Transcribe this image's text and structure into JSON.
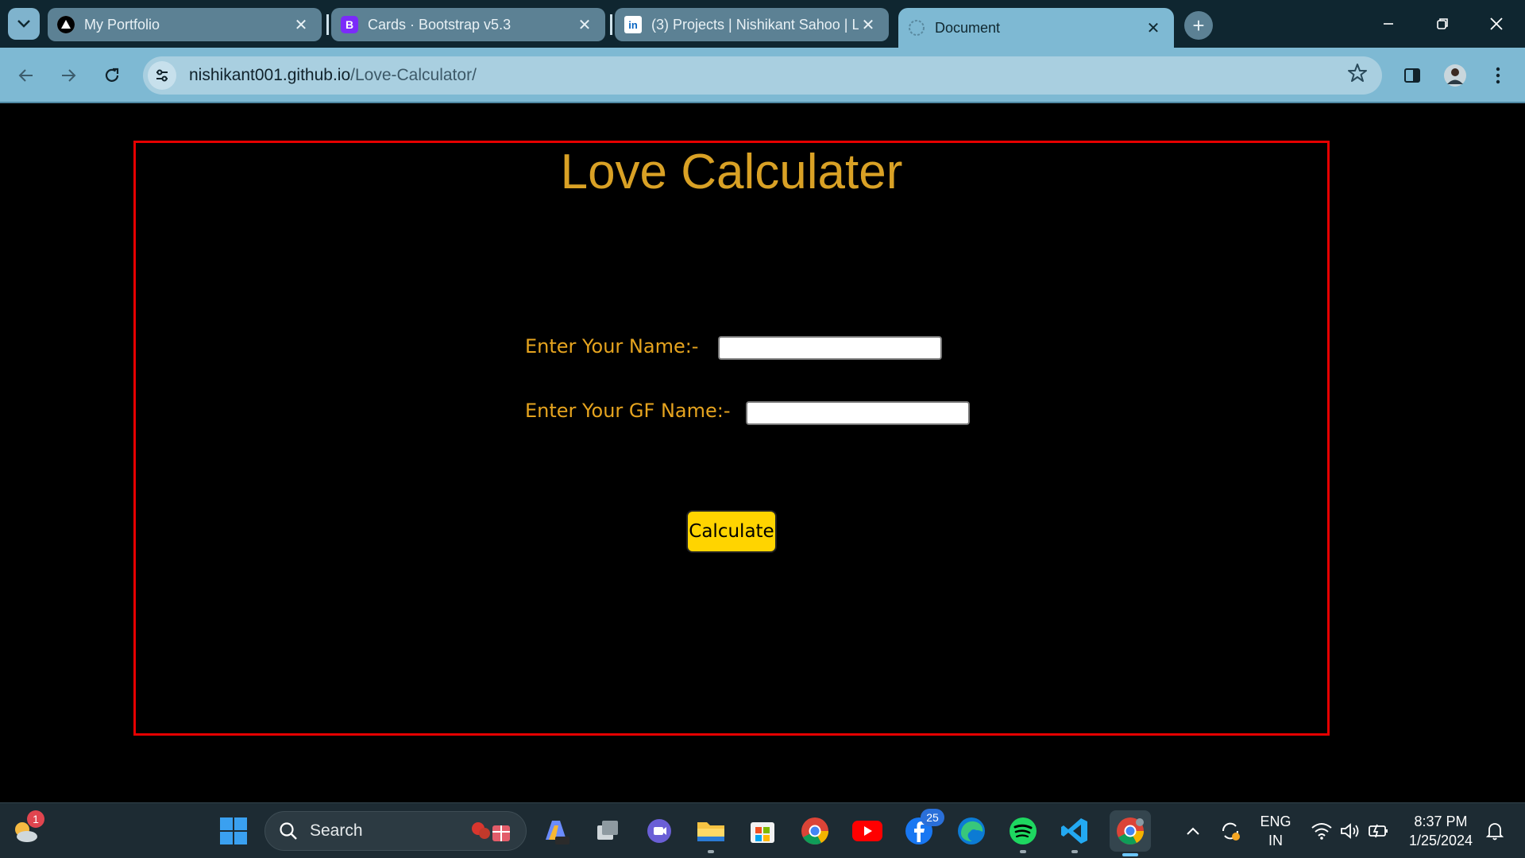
{
  "browser": {
    "tabs": [
      {
        "title": "My Portfolio",
        "favicon": "triangle-logo-icon",
        "active": false
      },
      {
        "title": "Cards · Bootstrap v5.3",
        "favicon": "bootstrap-icon",
        "active": false
      },
      {
        "title": "(3) Projects | Nishikant Sahoo | L",
        "favicon": "linkedin-icon",
        "active": false
      },
      {
        "title": "Document",
        "favicon": "globe-icon",
        "active": true
      }
    ],
    "favicon_letters": {
      "bootstrap": "B",
      "linkedin": "in"
    },
    "close_glyph": "✕",
    "new_tab_glyph": "+",
    "url_host": "nishikant001.github.io",
    "url_path": "/Love-Calculator/",
    "colors": {
      "chrome_top": "#0f2630",
      "chrome_toolbar": "#7eb9d3"
    }
  },
  "page": {
    "title": "Love Calculater",
    "name_label": "Enter Your Name:-",
    "name_value": "",
    "gf_label": "Enter Your GF Name:-",
    "gf_value": "",
    "button_label": "Calculate",
    "colors": {
      "title": "#d9a125",
      "label": "#e6a41f",
      "button": "#ffd400",
      "frame_border": "#e60000"
    }
  },
  "taskbar": {
    "search_label": "Search",
    "weather_badge": "1",
    "notification_badge": "25",
    "lang_line1": "ENG",
    "lang_line2": "IN",
    "time": "8:37 PM",
    "date": "1/25/2024",
    "apps": [
      "weather-icon",
      "start-icon",
      "search-icon",
      "copilot-icon",
      "task-view-icon",
      "teams-icon",
      "file-explorer-icon",
      "store-icon",
      "chrome-icon",
      "youtube-icon",
      "facebook-icon",
      "edge-icon",
      "spotify-icon",
      "vscode-icon",
      "chrome-active-icon"
    ]
  }
}
